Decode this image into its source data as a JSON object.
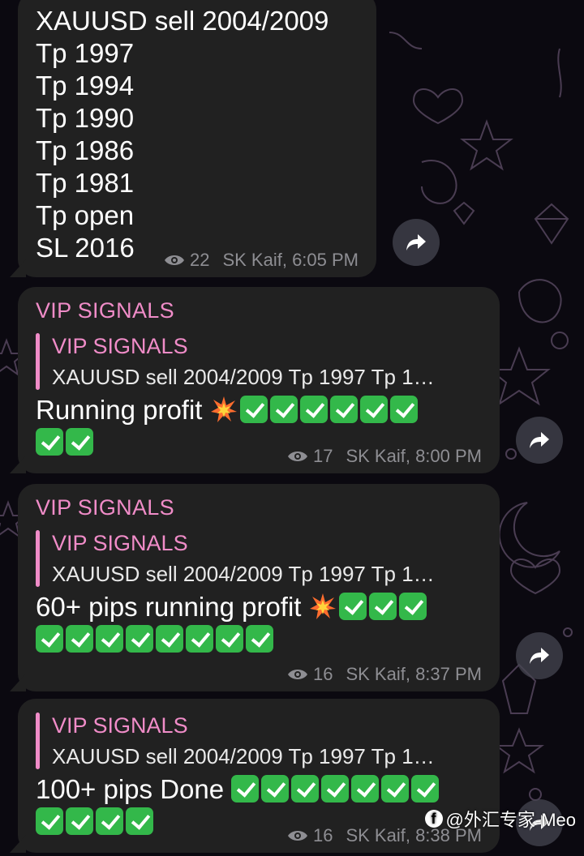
{
  "messages": [
    {
      "lines": [
        "XAUUSD sell 2004/2009",
        "Tp 1997",
        "Tp 1994",
        "Tp 1990",
        "Tp 1986",
        "Tp 1981",
        "Tp open",
        "SL 2016"
      ],
      "views": "22",
      "author_time": "SK Kaif, 6:05 PM"
    },
    {
      "sender": "VIP SIGNALS",
      "reply_title": "VIP SIGNALS",
      "reply_text": "XAUUSD sell 2004/2009 Tp 1997 Tp 1…",
      "text": "Running profit",
      "views": "17",
      "author_time": "SK Kaif, 8:00 PM"
    },
    {
      "sender": "VIP SIGNALS",
      "reply_title": "VIP SIGNALS",
      "reply_text": "XAUUSD sell 2004/2009 Tp 1997 Tp 1…",
      "text": "60+ pips running profit",
      "views": "16",
      "author_time": "SK Kaif, 8:37 PM"
    },
    {
      "reply_title": "VIP SIGNALS",
      "reply_text": "XAUUSD sell 2004/2009 Tp 1997 Tp 1…",
      "text": "100+ pips Done",
      "views": "16",
      "author_time": "SK Kaif, 8:38 PM"
    }
  ],
  "watermark": "@外汇专家-Meo",
  "icons": {
    "views": "eye-icon",
    "share": "share-arrow-icon",
    "check": "check-mark-emoji",
    "collision": "collision-emoji"
  },
  "colors": {
    "bubble": "#212121",
    "accent": "#f08cc8",
    "meta": "#8e8e93",
    "check": "#33b84a"
  }
}
